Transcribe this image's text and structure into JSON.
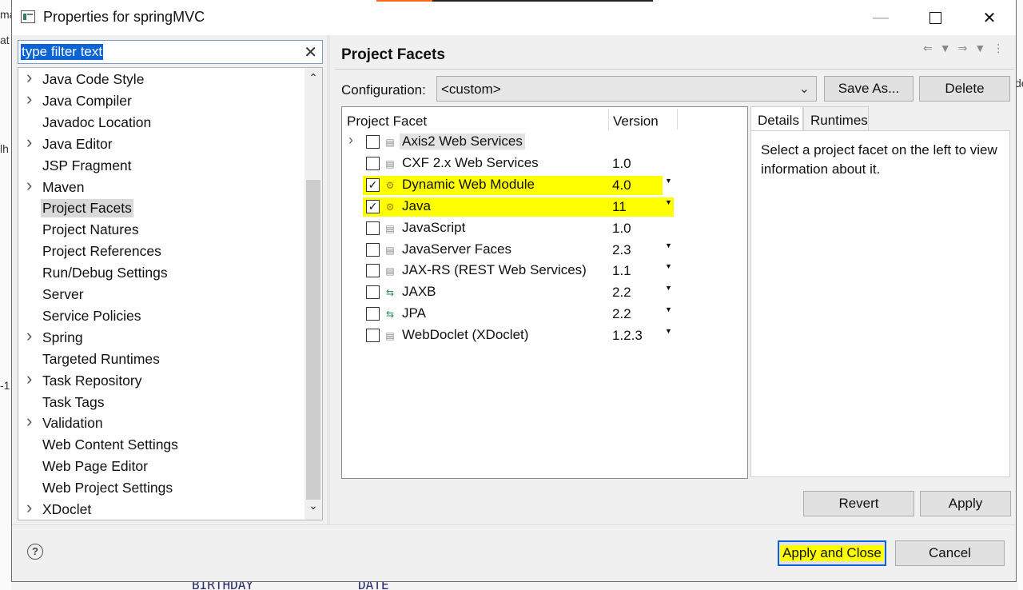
{
  "window": {
    "title": "Properties for springMVC"
  },
  "background": {
    "left_text_1": "ma",
    "left_text_2": "at",
    "left_text_3": "lh",
    "left_text_4": "-1",
    "right_text_1": "de",
    "bottom_text_1": "BIRTHDAY",
    "bottom_text_2": "DATE"
  },
  "filter": {
    "value": "type filter text"
  },
  "tree": {
    "items": [
      {
        "label": "Java Code Style",
        "expandable": true
      },
      {
        "label": "Java Compiler",
        "expandable": true
      },
      {
        "label": "Javadoc Location",
        "expandable": false
      },
      {
        "label": "Java Editor",
        "expandable": true
      },
      {
        "label": "JSP Fragment",
        "expandable": false
      },
      {
        "label": "Maven",
        "expandable": true
      },
      {
        "label": "Project Facets",
        "expandable": false,
        "selected": true
      },
      {
        "label": "Project Natures",
        "expandable": false
      },
      {
        "label": "Project References",
        "expandable": false
      },
      {
        "label": "Run/Debug Settings",
        "expandable": false
      },
      {
        "label": "Server",
        "expandable": false
      },
      {
        "label": "Service Policies",
        "expandable": false
      },
      {
        "label": "Spring",
        "expandable": true
      },
      {
        "label": "Targeted Runtimes",
        "expandable": false
      },
      {
        "label": "Task Repository",
        "expandable": true
      },
      {
        "label": "Task Tags",
        "expandable": false
      },
      {
        "label": "Validation",
        "expandable": true
      },
      {
        "label": "Web Content Settings",
        "expandable": false
      },
      {
        "label": "Web Page Editor",
        "expandable": false
      },
      {
        "label": "Web Project Settings",
        "expandable": false
      },
      {
        "label": "XDoclet",
        "expandable": true
      }
    ]
  },
  "page": {
    "title": "Project Facets"
  },
  "configuration": {
    "label": "Configuration:",
    "value": "<custom>",
    "save_as": "Save As...",
    "delete": "Delete"
  },
  "facets": {
    "col_facet": "Project Facet",
    "col_version": "Version",
    "rows": [
      {
        "name": "Axis2 Web Services",
        "version": "",
        "checked": false,
        "expander": true,
        "dropdown": false,
        "highlight": 0
      },
      {
        "name": "CXF 2.x Web Services",
        "version": "1.0",
        "checked": false,
        "expander": false,
        "dropdown": false,
        "highlight": 0
      },
      {
        "name": "Dynamic Web Module",
        "version": "4.0",
        "checked": true,
        "expander": false,
        "dropdown": true,
        "highlight": 1
      },
      {
        "name": "Java",
        "version": "11",
        "checked": true,
        "expander": false,
        "dropdown": true,
        "highlight": 2
      },
      {
        "name": "JavaScript",
        "version": "1.0",
        "checked": false,
        "expander": false,
        "dropdown": false,
        "highlight": 0
      },
      {
        "name": "JavaServer Faces",
        "version": "2.3",
        "checked": false,
        "expander": false,
        "dropdown": true,
        "highlight": 0
      },
      {
        "name": "JAX-RS (REST Web Services)",
        "version": "1.1",
        "checked": false,
        "expander": false,
        "dropdown": true,
        "highlight": 0
      },
      {
        "name": "JAXB",
        "version": "2.2",
        "checked": false,
        "expander": false,
        "dropdown": true,
        "highlight": 0
      },
      {
        "name": "JPA",
        "version": "2.2",
        "checked": false,
        "expander": false,
        "dropdown": true,
        "highlight": 0
      },
      {
        "name": "WebDoclet (XDoclet)",
        "version": "1.2.3",
        "checked": false,
        "expander": false,
        "dropdown": true,
        "highlight": 0
      }
    ]
  },
  "details": {
    "tab_details": "Details",
    "tab_runtimes": "Runtimes",
    "text": "Select a project facet on the left to view information about it."
  },
  "buttons": {
    "revert": "Revert",
    "apply": "Apply",
    "apply_and_close": "Apply and Close",
    "cancel": "Cancel"
  },
  "icons": {
    "help": "?",
    "close": "✕",
    "minimize": "—"
  }
}
